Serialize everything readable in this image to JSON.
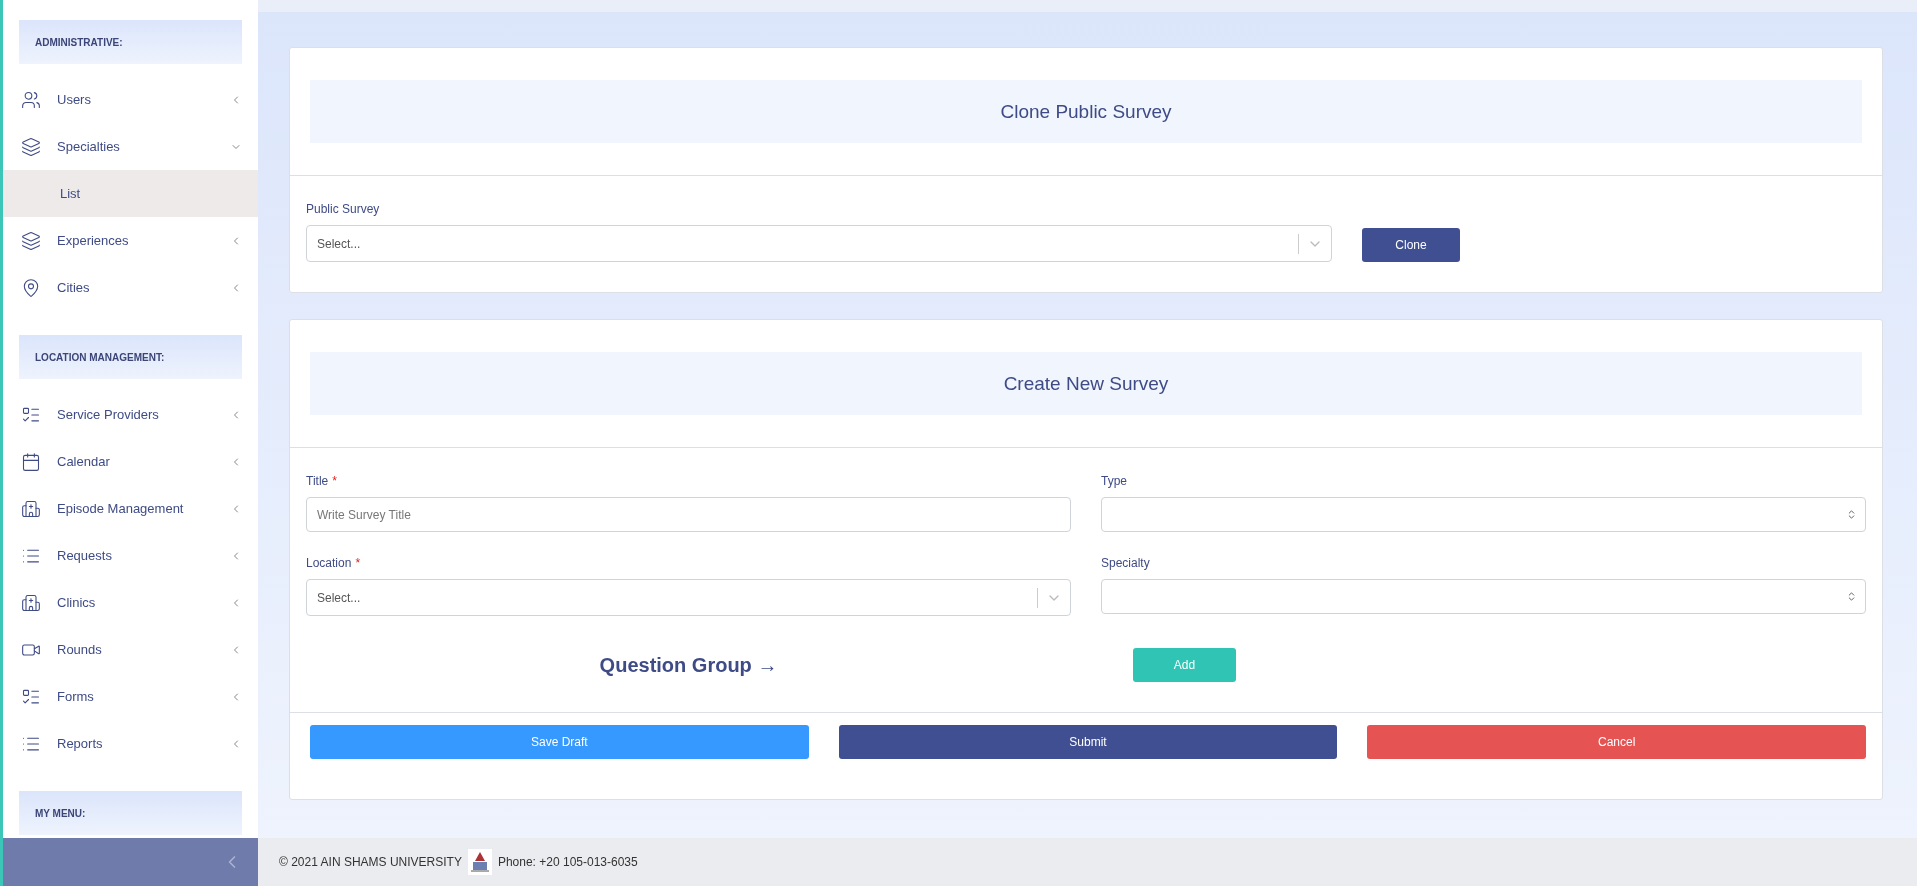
{
  "sidebar": {
    "sections": [
      {
        "title": "ADMINISTRATIVE:",
        "items": [
          {
            "label": "Users",
            "kind": "users",
            "expanded": false,
            "selected": false
          },
          {
            "label": "Specialties",
            "kind": "layers",
            "expanded": true,
            "selected": false,
            "children": [
              {
                "label": "List",
                "selected": true
              }
            ]
          },
          {
            "label": "Experiences",
            "kind": "layers",
            "expanded": false,
            "selected": false
          },
          {
            "label": "Cities",
            "kind": "pin",
            "expanded": false,
            "selected": false
          }
        ]
      },
      {
        "title": "LOCATION MANAGEMENT:",
        "items": [
          {
            "label": "Service Providers",
            "kind": "boxlist",
            "expanded": false,
            "selected": false
          },
          {
            "label": "Calendar",
            "kind": "calendar",
            "expanded": false,
            "selected": false
          },
          {
            "label": "Episode Management",
            "kind": "building",
            "expanded": false,
            "selected": false
          },
          {
            "label": "Requests",
            "kind": "dotlist",
            "expanded": false,
            "selected": false
          },
          {
            "label": "Clinics",
            "kind": "building",
            "expanded": false,
            "selected": false
          },
          {
            "label": "Rounds",
            "kind": "video",
            "expanded": false,
            "selected": false
          },
          {
            "label": "Forms",
            "kind": "boxlist",
            "expanded": false,
            "selected": false
          },
          {
            "label": "Reports",
            "kind": "dotlist",
            "expanded": false,
            "selected": false
          }
        ]
      },
      {
        "title": "MY MENU:"
      }
    ]
  },
  "clone_card": {
    "title": "Clone Public Survey",
    "field": {
      "label": "Public Survey",
      "placeholder": "Select..."
    },
    "button": "Clone"
  },
  "create_card": {
    "title": "Create New Survey",
    "fields": [
      {
        "label": "Title",
        "required_mark": "*",
        "kind": "text",
        "placeholder": "Write Survey Title"
      },
      {
        "label": "Type",
        "kind": "native-select"
      },
      {
        "label": "Location",
        "required_mark": "*",
        "kind": "search-select",
        "placeholder": "Select..."
      },
      {
        "label": "Specialty",
        "kind": "native-select"
      }
    ],
    "question_group": "Question Group →",
    "add_button": "Add",
    "actions": [
      {
        "label": "Save Draft",
        "kind": "save"
      },
      {
        "label": "Submit",
        "kind": "submit"
      },
      {
        "label": "Cancel",
        "kind": "cancel"
      }
    ]
  },
  "footer": {
    "copyright": "© 2021 AIN SHAMS UNIVERSITY",
    "phone": "Phone: +20 105-013-6035"
  }
}
